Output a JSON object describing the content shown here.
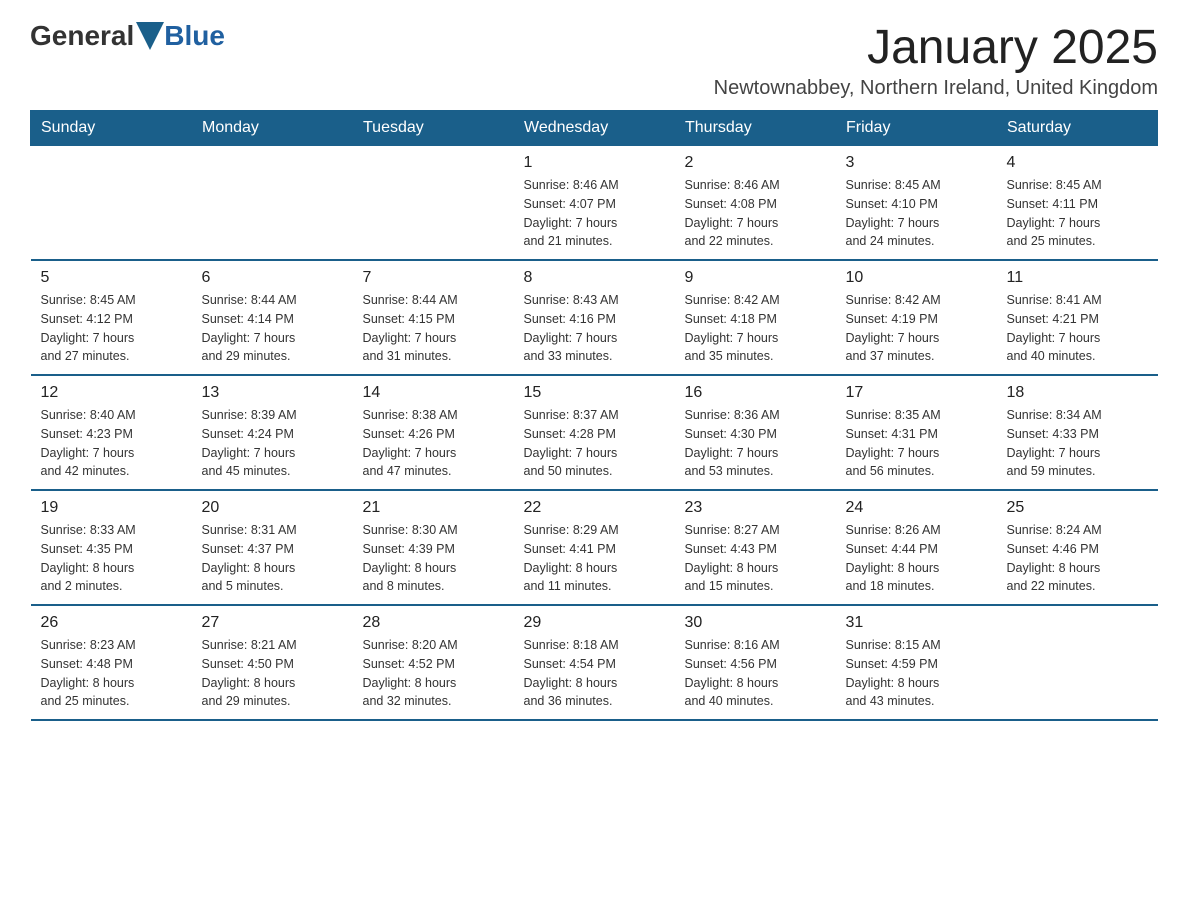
{
  "logo": {
    "general": "General",
    "blue": "Blue"
  },
  "title": "January 2025",
  "location": "Newtownabbey, Northern Ireland, United Kingdom",
  "weekdays": [
    "Sunday",
    "Monday",
    "Tuesday",
    "Wednesday",
    "Thursday",
    "Friday",
    "Saturday"
  ],
  "weeks": [
    [
      {
        "day": "",
        "info": ""
      },
      {
        "day": "",
        "info": ""
      },
      {
        "day": "",
        "info": ""
      },
      {
        "day": "1",
        "info": "Sunrise: 8:46 AM\nSunset: 4:07 PM\nDaylight: 7 hours\nand 21 minutes."
      },
      {
        "day": "2",
        "info": "Sunrise: 8:46 AM\nSunset: 4:08 PM\nDaylight: 7 hours\nand 22 minutes."
      },
      {
        "day": "3",
        "info": "Sunrise: 8:45 AM\nSunset: 4:10 PM\nDaylight: 7 hours\nand 24 minutes."
      },
      {
        "day": "4",
        "info": "Sunrise: 8:45 AM\nSunset: 4:11 PM\nDaylight: 7 hours\nand 25 minutes."
      }
    ],
    [
      {
        "day": "5",
        "info": "Sunrise: 8:45 AM\nSunset: 4:12 PM\nDaylight: 7 hours\nand 27 minutes."
      },
      {
        "day": "6",
        "info": "Sunrise: 8:44 AM\nSunset: 4:14 PM\nDaylight: 7 hours\nand 29 minutes."
      },
      {
        "day": "7",
        "info": "Sunrise: 8:44 AM\nSunset: 4:15 PM\nDaylight: 7 hours\nand 31 minutes."
      },
      {
        "day": "8",
        "info": "Sunrise: 8:43 AM\nSunset: 4:16 PM\nDaylight: 7 hours\nand 33 minutes."
      },
      {
        "day": "9",
        "info": "Sunrise: 8:42 AM\nSunset: 4:18 PM\nDaylight: 7 hours\nand 35 minutes."
      },
      {
        "day": "10",
        "info": "Sunrise: 8:42 AM\nSunset: 4:19 PM\nDaylight: 7 hours\nand 37 minutes."
      },
      {
        "day": "11",
        "info": "Sunrise: 8:41 AM\nSunset: 4:21 PM\nDaylight: 7 hours\nand 40 minutes."
      }
    ],
    [
      {
        "day": "12",
        "info": "Sunrise: 8:40 AM\nSunset: 4:23 PM\nDaylight: 7 hours\nand 42 minutes."
      },
      {
        "day": "13",
        "info": "Sunrise: 8:39 AM\nSunset: 4:24 PM\nDaylight: 7 hours\nand 45 minutes."
      },
      {
        "day": "14",
        "info": "Sunrise: 8:38 AM\nSunset: 4:26 PM\nDaylight: 7 hours\nand 47 minutes."
      },
      {
        "day": "15",
        "info": "Sunrise: 8:37 AM\nSunset: 4:28 PM\nDaylight: 7 hours\nand 50 minutes."
      },
      {
        "day": "16",
        "info": "Sunrise: 8:36 AM\nSunset: 4:30 PM\nDaylight: 7 hours\nand 53 minutes."
      },
      {
        "day": "17",
        "info": "Sunrise: 8:35 AM\nSunset: 4:31 PM\nDaylight: 7 hours\nand 56 minutes."
      },
      {
        "day": "18",
        "info": "Sunrise: 8:34 AM\nSunset: 4:33 PM\nDaylight: 7 hours\nand 59 minutes."
      }
    ],
    [
      {
        "day": "19",
        "info": "Sunrise: 8:33 AM\nSunset: 4:35 PM\nDaylight: 8 hours\nand 2 minutes."
      },
      {
        "day": "20",
        "info": "Sunrise: 8:31 AM\nSunset: 4:37 PM\nDaylight: 8 hours\nand 5 minutes."
      },
      {
        "day": "21",
        "info": "Sunrise: 8:30 AM\nSunset: 4:39 PM\nDaylight: 8 hours\nand 8 minutes."
      },
      {
        "day": "22",
        "info": "Sunrise: 8:29 AM\nSunset: 4:41 PM\nDaylight: 8 hours\nand 11 minutes."
      },
      {
        "day": "23",
        "info": "Sunrise: 8:27 AM\nSunset: 4:43 PM\nDaylight: 8 hours\nand 15 minutes."
      },
      {
        "day": "24",
        "info": "Sunrise: 8:26 AM\nSunset: 4:44 PM\nDaylight: 8 hours\nand 18 minutes."
      },
      {
        "day": "25",
        "info": "Sunrise: 8:24 AM\nSunset: 4:46 PM\nDaylight: 8 hours\nand 22 minutes."
      }
    ],
    [
      {
        "day": "26",
        "info": "Sunrise: 8:23 AM\nSunset: 4:48 PM\nDaylight: 8 hours\nand 25 minutes."
      },
      {
        "day": "27",
        "info": "Sunrise: 8:21 AM\nSunset: 4:50 PM\nDaylight: 8 hours\nand 29 minutes."
      },
      {
        "day": "28",
        "info": "Sunrise: 8:20 AM\nSunset: 4:52 PM\nDaylight: 8 hours\nand 32 minutes."
      },
      {
        "day": "29",
        "info": "Sunrise: 8:18 AM\nSunset: 4:54 PM\nDaylight: 8 hours\nand 36 minutes."
      },
      {
        "day": "30",
        "info": "Sunrise: 8:16 AM\nSunset: 4:56 PM\nDaylight: 8 hours\nand 40 minutes."
      },
      {
        "day": "31",
        "info": "Sunrise: 8:15 AM\nSunset: 4:59 PM\nDaylight: 8 hours\nand 43 minutes."
      },
      {
        "day": "",
        "info": ""
      }
    ]
  ]
}
